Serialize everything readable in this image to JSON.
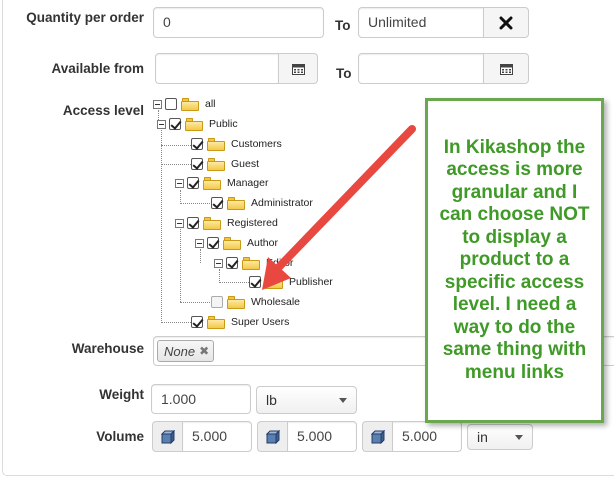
{
  "quantity": {
    "label": "Quantity per order",
    "from_value": "0",
    "to_label": "To",
    "to_value": "Unlimited",
    "clear_icon": "x-icon"
  },
  "available": {
    "label": "Available from",
    "from_value": "",
    "to_label": "To",
    "to_value": "",
    "calendar_icon": "calendar-icon"
  },
  "access": {
    "label": "Access level",
    "tree": [
      {
        "label": "all",
        "checked": false
      },
      {
        "label": "Public",
        "checked": true
      },
      {
        "label": "Customers",
        "checked": true
      },
      {
        "label": "Guest",
        "checked": true
      },
      {
        "label": "Manager",
        "checked": true
      },
      {
        "label": "Administrator",
        "checked": true
      },
      {
        "label": "Registered",
        "checked": true
      },
      {
        "label": "Author",
        "checked": true
      },
      {
        "label": "Editor",
        "checked": true
      },
      {
        "label": "Publisher",
        "checked": true
      },
      {
        "label": "Wholesale",
        "checked": false
      },
      {
        "label": "Super Users",
        "checked": true
      }
    ]
  },
  "warehouse": {
    "label": "Warehouse",
    "chip": "None"
  },
  "weight": {
    "label": "Weight",
    "value": "1.000",
    "unit": "lb"
  },
  "volume": {
    "label": "Volume",
    "x": "5.000",
    "y": "5.000",
    "z": "5.000",
    "unit": "in"
  },
  "callout": {
    "text": "In Kikashop the access is more granular and I can choose NOT to display a product to a specific access level. I need a way to do the same thing with menu links"
  },
  "colors": {
    "callout_text": "#3f9a27",
    "callout_border": "#6aa84f",
    "arrow": "#e8483f"
  }
}
